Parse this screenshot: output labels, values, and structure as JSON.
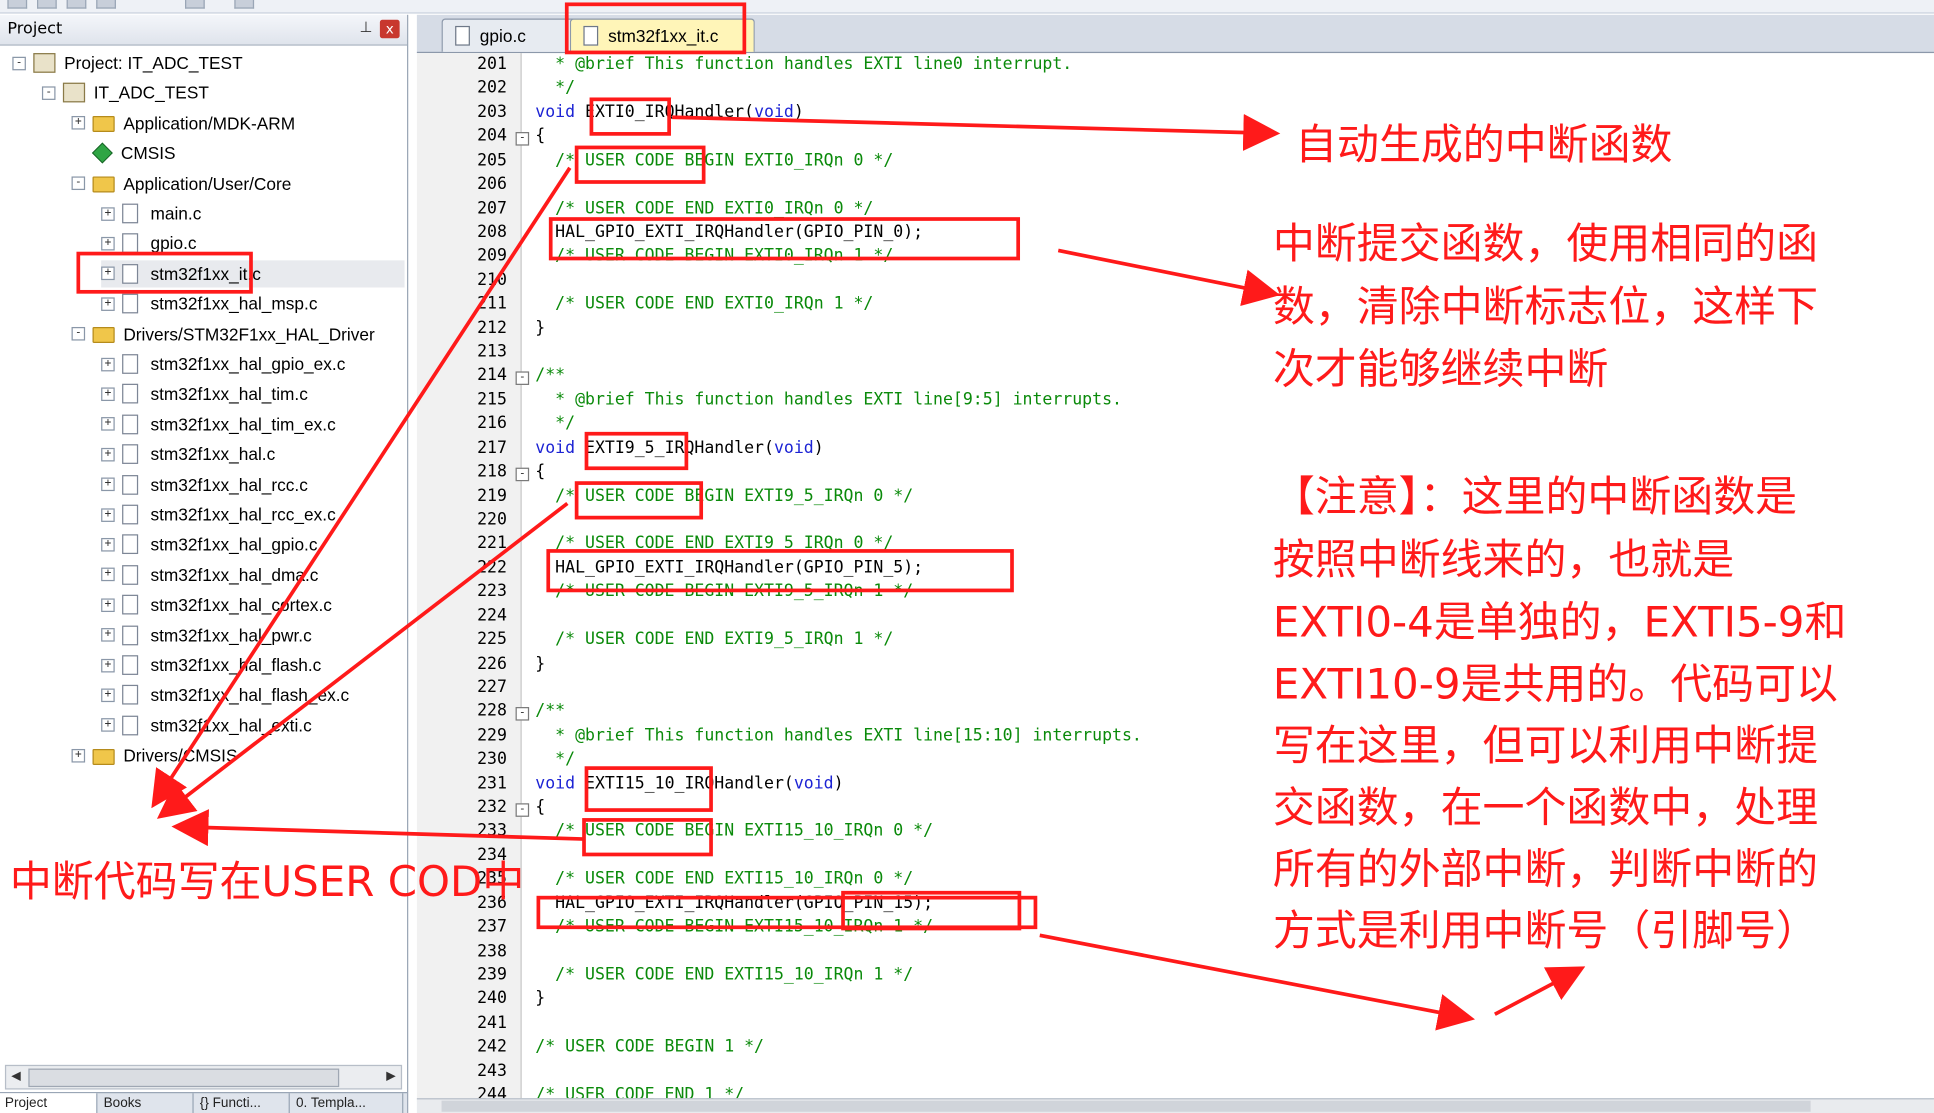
{
  "project_panel": {
    "title": "Project",
    "pin_icon": "pin-icon",
    "close_label": "x",
    "tree": [
      {
        "label": "Project: IT_ADC_TEST",
        "icon": "project-icon"
      },
      {
        "label": "IT_ADC_TEST",
        "icon": "target-icon"
      },
      {
        "label": "Application/MDK-ARM",
        "icon": "folder-icon"
      },
      {
        "label": "CMSIS",
        "icon": "cmsis-icon"
      },
      {
        "label": "Application/User/Core",
        "icon": "folder-icon"
      },
      {
        "label": "main.c",
        "icon": "file-icon"
      },
      {
        "label": "gpio.c",
        "icon": "file-icon"
      },
      {
        "label": "stm32f1xx_it.c",
        "icon": "file-icon"
      },
      {
        "label": "stm32f1xx_hal_msp.c",
        "icon": "file-icon"
      },
      {
        "label": "Drivers/STM32F1xx_HAL_Driver",
        "icon": "folder-icon"
      },
      {
        "label": "stm32f1xx_hal_gpio_ex.c",
        "icon": "file-icon"
      },
      {
        "label": "stm32f1xx_hal_tim.c",
        "icon": "file-icon"
      },
      {
        "label": "stm32f1xx_hal_tim_ex.c",
        "icon": "file-icon"
      },
      {
        "label": "stm32f1xx_hal.c",
        "icon": "file-icon"
      },
      {
        "label": "stm32f1xx_hal_rcc.c",
        "icon": "file-icon"
      },
      {
        "label": "stm32f1xx_hal_rcc_ex.c",
        "icon": "file-icon"
      },
      {
        "label": "stm32f1xx_hal_gpio.c",
        "icon": "file-icon"
      },
      {
        "label": "stm32f1xx_hal_dma.c",
        "icon": "file-icon"
      },
      {
        "label": "stm32f1xx_hal_cortex.c",
        "icon": "file-icon"
      },
      {
        "label": "stm32f1xx_hal_pwr.c",
        "icon": "file-icon"
      },
      {
        "label": "stm32f1xx_hal_flash.c",
        "icon": "file-icon"
      },
      {
        "label": "stm32f1xx_hal_flash_ex.c",
        "icon": "file-icon"
      },
      {
        "label": "stm32f1xx_hal_exti.c",
        "icon": "file-icon"
      },
      {
        "label": "Drivers/CMSIS",
        "icon": "folder-icon"
      }
    ],
    "bottom_tabs": [
      "Project",
      "Books",
      "{} Functi...",
      "0. Templa..."
    ]
  },
  "editor": {
    "tabs": [
      {
        "label": "gpio.c",
        "active": false
      },
      {
        "label": "stm32f1xx_it.c",
        "active": true
      }
    ],
    "lines": [
      {
        "n": "201",
        "text": "  * @brief This function handles EXTI line0 interrupt."
      },
      {
        "n": "202",
        "text": "  */"
      },
      {
        "n": "203",
        "text": "void EXTI0_IRQHandler(void)"
      },
      {
        "n": "204",
        "text": "{"
      },
      {
        "n": "205",
        "text": "  /* USER CODE BEGIN EXTI0_IRQn 0 */"
      },
      {
        "n": "206",
        "text": ""
      },
      {
        "n": "207",
        "text": "  /* USER CODE END EXTI0_IRQn 0 */"
      },
      {
        "n": "208",
        "text": "  HAL_GPIO_EXTI_IRQHandler(GPIO_PIN_0);"
      },
      {
        "n": "209",
        "text": "  /* USER CODE BEGIN EXTI0_IRQn 1 */"
      },
      {
        "n": "210",
        "text": ""
      },
      {
        "n": "211",
        "text": "  /* USER CODE END EXTI0_IRQn 1 */"
      },
      {
        "n": "212",
        "text": "}"
      },
      {
        "n": "213",
        "text": ""
      },
      {
        "n": "214",
        "text": "/**"
      },
      {
        "n": "215",
        "text": "  * @brief This function handles EXTI line[9:5] interrupts."
      },
      {
        "n": "216",
        "text": "  */"
      },
      {
        "n": "217",
        "text": "void EXTI9_5_IRQHandler(void)"
      },
      {
        "n": "218",
        "text": "{"
      },
      {
        "n": "219",
        "text": "  /* USER CODE BEGIN EXTI9_5_IRQn 0 */"
      },
      {
        "n": "220",
        "text": ""
      },
      {
        "n": "221",
        "text": "  /* USER CODE END EXTI9_5_IRQn 0 */"
      },
      {
        "n": "222",
        "text": "  HAL_GPIO_EXTI_IRQHandler(GPIO_PIN_5);"
      },
      {
        "n": "223",
        "text": "  /* USER CODE BEGIN EXTI9_5_IRQn 1 */"
      },
      {
        "n": "224",
        "text": ""
      },
      {
        "n": "225",
        "text": "  /* USER CODE END EXTI9_5_IRQn 1 */"
      },
      {
        "n": "226",
        "text": "}"
      },
      {
        "n": "227",
        "text": ""
      },
      {
        "n": "228",
        "text": "/**"
      },
      {
        "n": "229",
        "text": "  * @brief This function handles EXTI line[15:10] interrupts."
      },
      {
        "n": "230",
        "text": "  */"
      },
      {
        "n": "231",
        "text": "void EXTI15_10_IRQHandler(void)"
      },
      {
        "n": "232",
        "text": "{"
      },
      {
        "n": "233",
        "text": "  /* USER CODE BEGIN EXTI15_10_IRQn 0 */"
      },
      {
        "n": "234",
        "text": ""
      },
      {
        "n": "235",
        "text": "  /* USER CODE END EXTI15_10_IRQn 0 */"
      },
      {
        "n": "236",
        "text": "  HAL_GPIO_EXTI_IRQHandler(GPIO_PIN_15);"
      },
      {
        "n": "237",
        "text": "  /* USER CODE BEGIN EXTI15_10_IRQn 1 */"
      },
      {
        "n": "238",
        "text": ""
      },
      {
        "n": "239",
        "text": "  /* USER CODE END EXTI15_10_IRQn 1 */"
      },
      {
        "n": "240",
        "text": "}"
      },
      {
        "n": "241",
        "text": ""
      },
      {
        "n": "242",
        "text": "/* USER CODE BEGIN 1 */"
      },
      {
        "n": "243",
        "text": ""
      },
      {
        "n": "244",
        "text": "/* USER CODE END 1 */"
      }
    ]
  },
  "annotations": {
    "auto_generated": "自动生成的中断函数",
    "commit_function": [
      "中断提交函数，使用相同的函",
      "数，清除中断标志位，这样下",
      "次才能够继续中断"
    ],
    "note": [
      "【注意】：这里的中断函数是",
      "按照中断线来的，也就是",
      "EXTI0-4是单独的，EXTI5-9和",
      "EXTI10-9是共用的。代码可以",
      "写在这里，但可以利用中断提",
      "交函数，在一个函数中，处理",
      "所有的外部中断，判断中断的",
      "方式是利用中断号（引脚号）"
    ],
    "user_code_note": "中断代码写在USER COD中",
    "color": "#ff1a1a"
  },
  "colors": {
    "comment": "#0a8a0a",
    "keyword": "#1c23d4",
    "active_tab": "#fff5b8",
    "folder": "#f0c64a"
  }
}
